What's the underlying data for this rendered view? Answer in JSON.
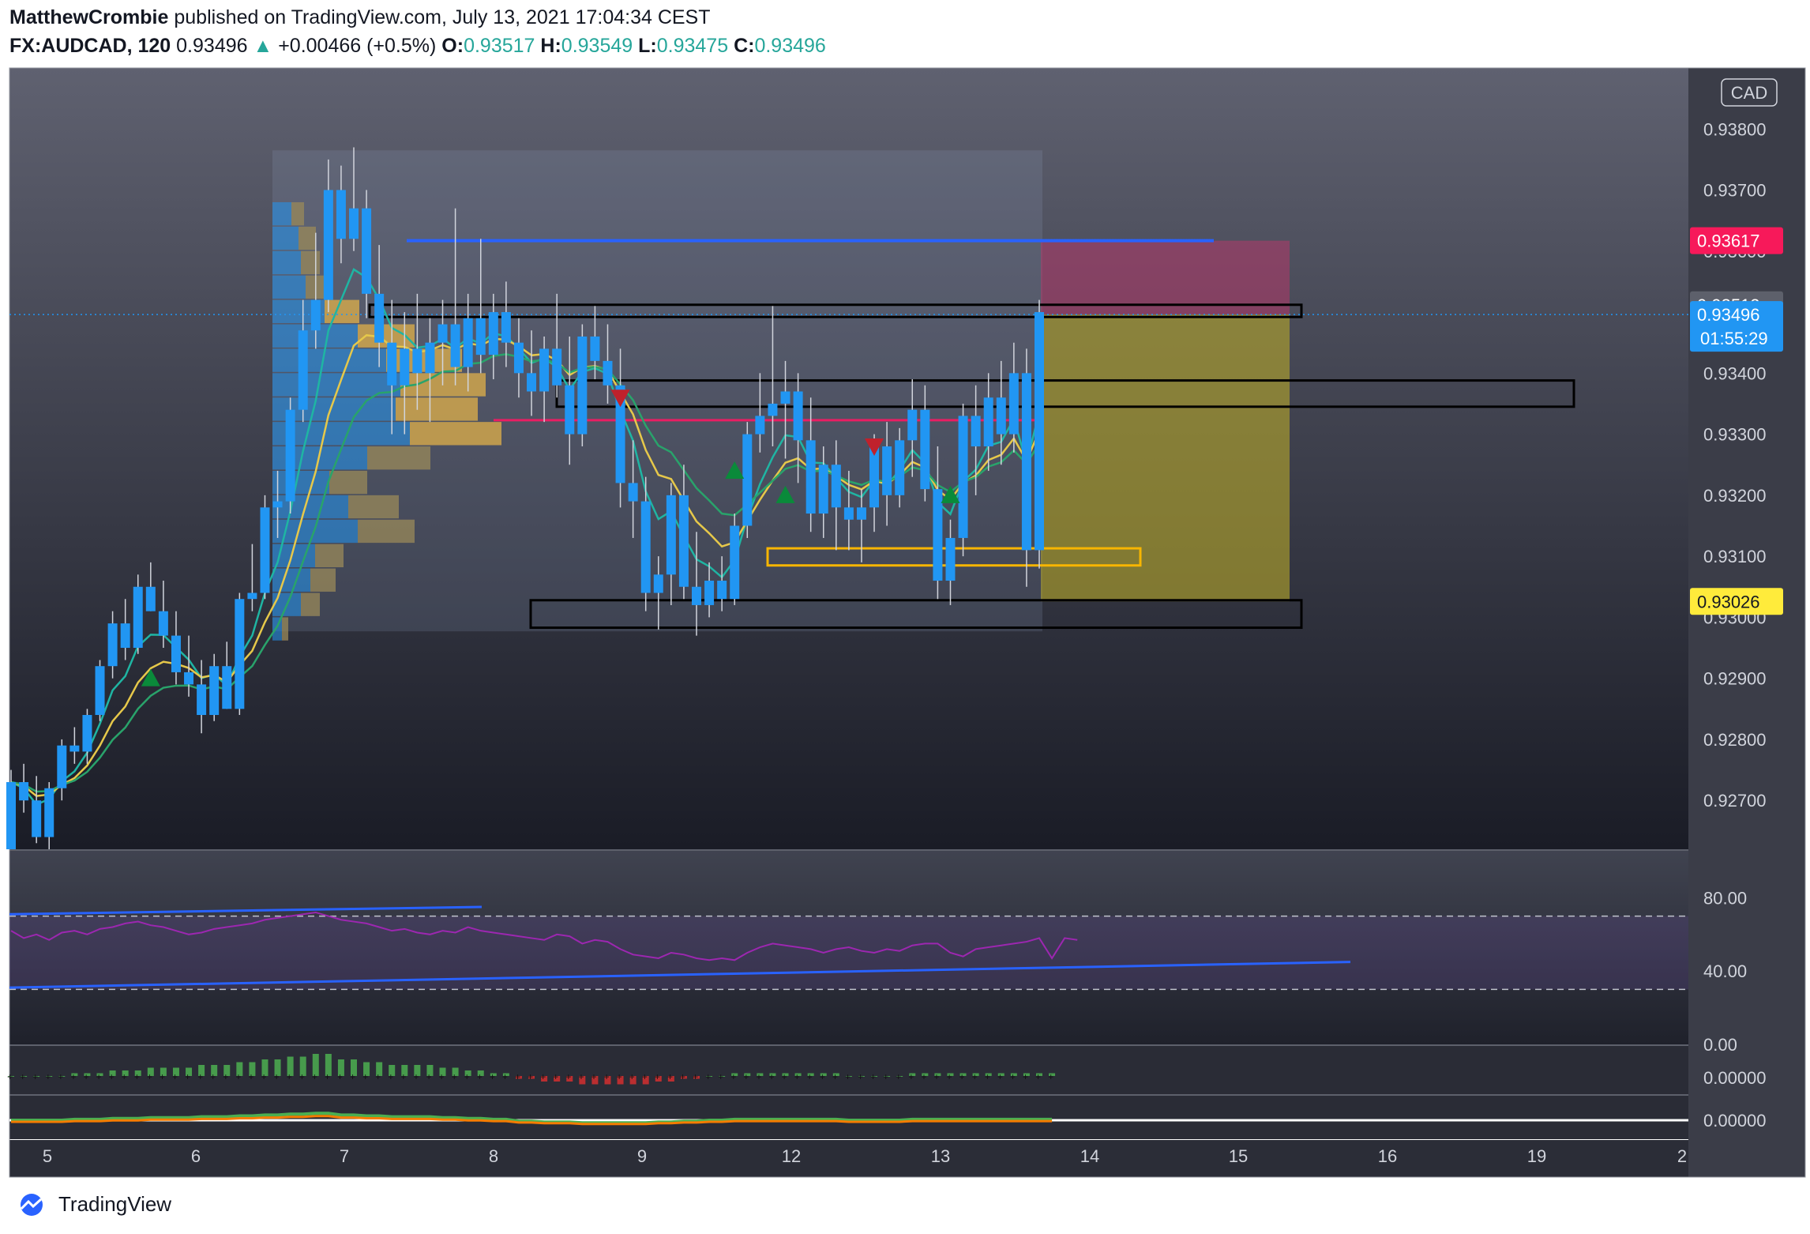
{
  "header": {
    "author": "MatthewCrombie",
    "published": "published on TradingView.com, July 13, 2021 17:04:34 CEST",
    "symbol": "FX:AUDCAD, 120",
    "last": "0.93496",
    "change": "+0.00466 (+0.5%)",
    "o_label": "O:",
    "o": "0.93517",
    "h_label": "H:",
    "h": "0.93549",
    "l_label": "L:",
    "l": "0.93475",
    "c_label": "C:",
    "c": "0.93496"
  },
  "footer": {
    "brand": "TradingView"
  },
  "colors": {
    "bull": "#2196f3",
    "bear": "#2196f3",
    "resistance": "#f23645",
    "price_tag": "#2196f3",
    "stop_tag": "#f7195a",
    "target_tag": "#ffeb3b"
  },
  "chart_data": {
    "type": "candlestick",
    "currency": "CAD",
    "ylim": [
      0.9262,
      0.939
    ],
    "y_ticks": [
      "0.93800",
      "0.93700",
      "0.93600",
      "0.93500",
      "0.93400",
      "0.93300",
      "0.93200",
      "0.93100",
      "0.93000",
      "0.92900",
      "0.92800",
      "0.92700"
    ],
    "y_tick_values": [
      0.938,
      0.937,
      0.936,
      0.935,
      0.934,
      0.933,
      0.932,
      0.931,
      0.93,
      0.929,
      0.928,
      0.927
    ],
    "x_ticks": [
      "5",
      "6",
      "7",
      "8",
      "9",
      "12",
      "13",
      "14",
      "15",
      "16",
      "19",
      "2"
    ],
    "price_tags": [
      {
        "label": "0.93617",
        "value": 0.93617,
        "kind": "stop"
      },
      {
        "label": "0.93512",
        "value": 0.93512,
        "kind": "high"
      },
      {
        "label": "0.93496",
        "sub": "01:55:29",
        "value": 0.93496,
        "kind": "last"
      },
      {
        "label": "0.93026",
        "value": 0.93026,
        "kind": "target"
      }
    ],
    "candles": [
      [
        0.9262,
        0.9275,
        0.9262,
        0.9273
      ],
      [
        0.9273,
        0.9276,
        0.9268,
        0.927
      ],
      [
        0.927,
        0.9274,
        0.9263,
        0.9264
      ],
      [
        0.9264,
        0.9273,
        0.9262,
        0.9272
      ],
      [
        0.9272,
        0.928,
        0.927,
        0.9279
      ],
      [
        0.9279,
        0.9282,
        0.9276,
        0.9278
      ],
      [
        0.9278,
        0.9285,
        0.9276,
        0.9284
      ],
      [
        0.9284,
        0.9293,
        0.9283,
        0.9292
      ],
      [
        0.9292,
        0.9301,
        0.929,
        0.9299
      ],
      [
        0.9299,
        0.9303,
        0.9293,
        0.9295
      ],
      [
        0.9295,
        0.9307,
        0.9294,
        0.9305
      ],
      [
        0.9305,
        0.9309,
        0.9301,
        0.9301
      ],
      [
        0.9301,
        0.9306,
        0.9295,
        0.9297
      ],
      [
        0.9297,
        0.9301,
        0.9289,
        0.9291
      ],
      [
        0.9291,
        0.9297,
        0.9287,
        0.9289
      ],
      [
        0.9289,
        0.9293,
        0.9281,
        0.9284
      ],
      [
        0.9284,
        0.9294,
        0.9283,
        0.9292
      ],
      [
        0.9292,
        0.9296,
        0.9285,
        0.9285
      ],
      [
        0.9285,
        0.9304,
        0.9284,
        0.9303
      ],
      [
        0.9303,
        0.9312,
        0.9301,
        0.9304
      ],
      [
        0.9304,
        0.932,
        0.9303,
        0.9318
      ],
      [
        0.9318,
        0.9324,
        0.9313,
        0.9319
      ],
      [
        0.9319,
        0.9336,
        0.9317,
        0.9334
      ],
      [
        0.9334,
        0.9352,
        0.9332,
        0.9347
      ],
      [
        0.9347,
        0.9363,
        0.9344,
        0.9352
      ],
      [
        0.9352,
        0.9375,
        0.935,
        0.937
      ],
      [
        0.937,
        0.9374,
        0.9358,
        0.9362
      ],
      [
        0.9362,
        0.9377,
        0.936,
        0.9367
      ],
      [
        0.9367,
        0.937,
        0.9349,
        0.9353
      ],
      [
        0.9353,
        0.9361,
        0.9341,
        0.9345
      ],
      [
        0.9345,
        0.9352,
        0.933,
        0.9338
      ],
      [
        0.9338,
        0.935,
        0.933,
        0.9344
      ],
      [
        0.9344,
        0.9353,
        0.9334,
        0.934
      ],
      [
        0.934,
        0.9349,
        0.9332,
        0.9345
      ],
      [
        0.9345,
        0.9352,
        0.9338,
        0.9348
      ],
      [
        0.9348,
        0.9367,
        0.9338,
        0.9341
      ],
      [
        0.9341,
        0.9353,
        0.9337,
        0.9349
      ],
      [
        0.9349,
        0.9362,
        0.934,
        0.9343
      ],
      [
        0.9343,
        0.9353,
        0.9339,
        0.935
      ],
      [
        0.935,
        0.9355,
        0.9341,
        0.9345
      ],
      [
        0.9345,
        0.9349,
        0.9336,
        0.934
      ],
      [
        0.934,
        0.9347,
        0.9333,
        0.9337
      ],
      [
        0.9337,
        0.9346,
        0.9332,
        0.9344
      ],
      [
        0.9344,
        0.9353,
        0.9336,
        0.9338
      ],
      [
        0.9338,
        0.9346,
        0.9325,
        0.933
      ],
      [
        0.933,
        0.9348,
        0.9328,
        0.9346
      ],
      [
        0.9346,
        0.9351,
        0.9339,
        0.9342
      ],
      [
        0.9342,
        0.9348,
        0.9335,
        0.9338
      ],
      [
        0.9338,
        0.9344,
        0.9318,
        0.9322
      ],
      [
        0.9322,
        0.9329,
        0.9313,
        0.9319
      ],
      [
        0.9319,
        0.9323,
        0.9301,
        0.9304
      ],
      [
        0.9304,
        0.931,
        0.9298,
        0.9307
      ],
      [
        0.9307,
        0.9322,
        0.9302,
        0.932
      ],
      [
        0.932,
        0.9325,
        0.9303,
        0.9305
      ],
      [
        0.9305,
        0.9314,
        0.9297,
        0.9302
      ],
      [
        0.9302,
        0.9309,
        0.93,
        0.9306
      ],
      [
        0.9306,
        0.931,
        0.9301,
        0.9303
      ],
      [
        0.9303,
        0.9317,
        0.9302,
        0.9315
      ],
      [
        0.9315,
        0.9332,
        0.9313,
        0.933
      ],
      [
        0.933,
        0.934,
        0.9327,
        0.9333
      ],
      [
        0.9333,
        0.9351,
        0.9328,
        0.9335
      ],
      [
        0.9335,
        0.9342,
        0.9326,
        0.9337
      ],
      [
        0.9337,
        0.934,
        0.9322,
        0.9329
      ],
      [
        0.9329,
        0.9336,
        0.9314,
        0.9317
      ],
      [
        0.9317,
        0.9328,
        0.9313,
        0.9325
      ],
      [
        0.9325,
        0.9329,
        0.9311,
        0.9318
      ],
      [
        0.9318,
        0.9324,
        0.9311,
        0.9316
      ],
      [
        0.9316,
        0.9321,
        0.9309,
        0.9318
      ],
      [
        0.9318,
        0.933,
        0.9314,
        0.9328
      ],
      [
        0.9328,
        0.9332,
        0.9315,
        0.932
      ],
      [
        0.932,
        0.9331,
        0.9318,
        0.9329
      ],
      [
        0.9329,
        0.9339,
        0.9323,
        0.9334
      ],
      [
        0.9334,
        0.9338,
        0.9319,
        0.9321
      ],
      [
        0.9321,
        0.9328,
        0.9303,
        0.9306
      ],
      [
        0.9306,
        0.9316,
        0.9302,
        0.9313
      ],
      [
        0.9313,
        0.9335,
        0.931,
        0.9333
      ],
      [
        0.9333,
        0.9338,
        0.932,
        0.9328
      ],
      [
        0.9328,
        0.934,
        0.9324,
        0.9336
      ],
      [
        0.9336,
        0.9342,
        0.9325,
        0.933
      ],
      [
        0.933,
        0.9345,
        0.9327,
        0.934
      ],
      [
        0.934,
        0.9344,
        0.9305,
        0.9311
      ],
      [
        0.9311,
        0.9352,
        0.9308,
        0.935
      ]
    ],
    "horizontal_lines": [
      {
        "value": 0.93617,
        "color": "#2962ff"
      },
      {
        "value": 0.93323,
        "color": "#e91e63"
      }
    ],
    "zones": [
      {
        "type": "rect",
        "top": 0.93512,
        "bottom": 0.93492,
        "color": "#000000"
      },
      {
        "type": "rect",
        "top": 0.93388,
        "bottom": 0.93345,
        "color": "#000000"
      },
      {
        "type": "rect",
        "top": 0.93113,
        "bottom": 0.93085,
        "color": "#f7b500"
      },
      {
        "type": "rect",
        "top": 0.93028,
        "bottom": 0.92983,
        "color": "#000000"
      }
    ],
    "position": {
      "entry": 0.93496,
      "stop": 0.93617,
      "target": 0.93026
    },
    "rsi": {
      "ylim": [
        0,
        100
      ],
      "y_ticks": [
        "80.00",
        "40.00",
        "0.00"
      ],
      "y_tick_values": [
        80,
        40,
        0
      ],
      "upper": 70,
      "lower": 30,
      "values": [
        62,
        58,
        60,
        57,
        61,
        62,
        60,
        63,
        64,
        66,
        67,
        65,
        64,
        62,
        60,
        61,
        63,
        64,
        65,
        66,
        68,
        69,
        70,
        71,
        72,
        70,
        68,
        67,
        66,
        64,
        62,
        63,
        61,
        60,
        62,
        61,
        64,
        62,
        61,
        60,
        59,
        58,
        57,
        60,
        59,
        55,
        57,
        56,
        52,
        49,
        48,
        47,
        50,
        49,
        47,
        46,
        47,
        46,
        50,
        53,
        55,
        54,
        53,
        52,
        50,
        52,
        53,
        51,
        50,
        52,
        51,
        54,
        55,
        55,
        50,
        48,
        52,
        53,
        54,
        55,
        56,
        58,
        47,
        58,
        57
      ]
    },
    "osc1": {
      "label": "0.00000",
      "values": [
        0,
        0,
        0,
        0,
        0,
        1,
        1,
        1,
        2,
        2,
        2,
        3,
        3,
        3,
        3,
        4,
        4,
        4,
        5,
        5,
        6,
        6,
        7,
        7,
        8,
        8,
        6,
        6,
        5,
        5,
        4,
        4,
        4,
        4,
        3,
        3,
        2,
        2,
        1,
        1,
        -1,
        -1,
        -2,
        -2,
        -2,
        -3,
        -3,
        -3,
        -3,
        -3,
        -3,
        -2,
        -2,
        -1,
        -1,
        0,
        0,
        1,
        1,
        1,
        1,
        1,
        1,
        1,
        1,
        1,
        0,
        0,
        0,
        0,
        0,
        1,
        1,
        1,
        1,
        1,
        1,
        1,
        1,
        1,
        1,
        1,
        1
      ]
    },
    "osc2": {
      "label": "0.00000"
    }
  }
}
